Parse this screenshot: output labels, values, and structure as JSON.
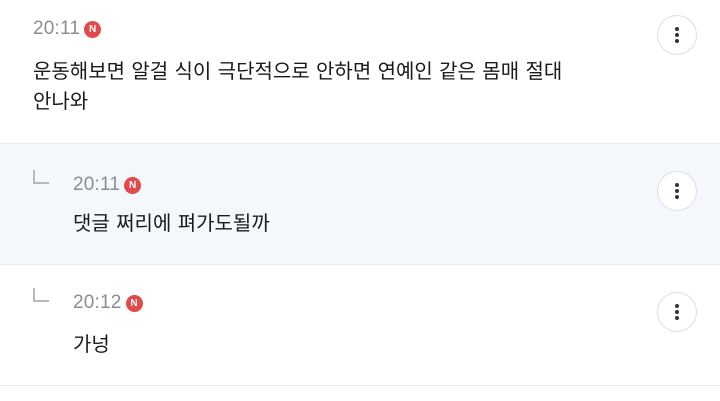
{
  "comments": [
    {
      "time": "20:11",
      "badge": "N",
      "text": "운동해보면 알걸 식이 극단적으로 안하면 연예인 같은 몸매 절대\n안나와",
      "is_reply": false
    },
    {
      "time": "20:11",
      "badge": "N",
      "text": "댓글 쩌리에 펴가도될까",
      "is_reply": true
    },
    {
      "time": "20:12",
      "badge": "N",
      "text": "가넝",
      "is_reply": true
    }
  ],
  "icons": {
    "more": "more-vertical-icon",
    "reply": "reply-arrow-icon",
    "new": "new-badge"
  },
  "colors": {
    "new_badge": "#e14a4a",
    "reply_background": "#f4f7fb",
    "time_text": "#8a8d92"
  }
}
